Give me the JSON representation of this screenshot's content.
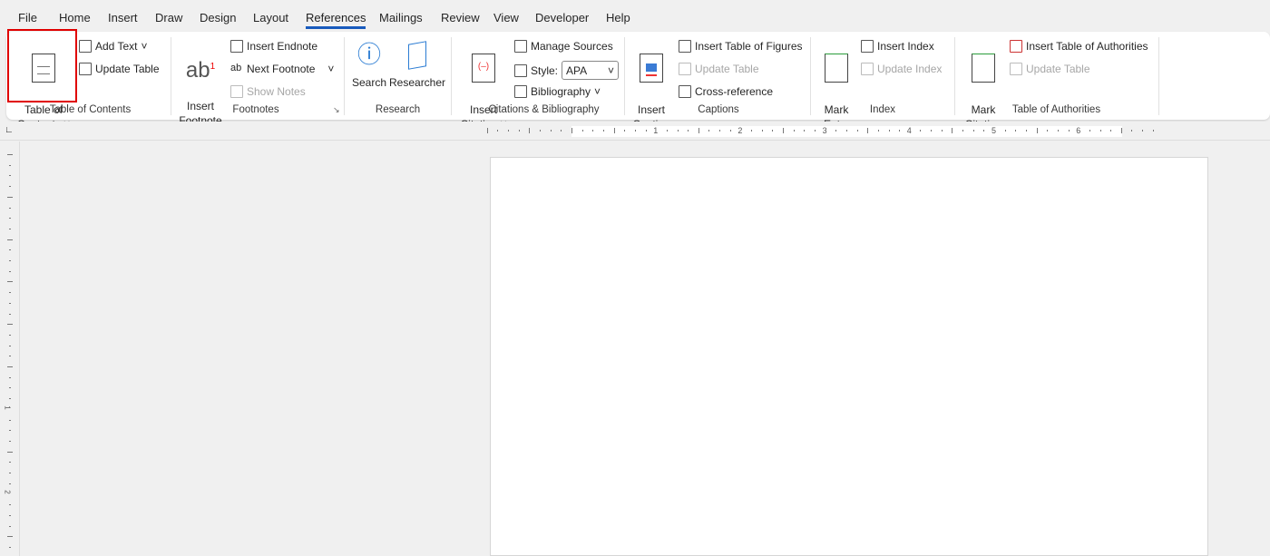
{
  "tabs": [
    "File",
    "Home",
    "Insert",
    "Draw",
    "Design",
    "Layout",
    "References",
    "Mailings",
    "Review",
    "View",
    "Developer",
    "Help"
  ],
  "active_tab": "References",
  "ribbon": {
    "toc": {
      "toc_button": "Table of\nContents",
      "add_text": "Add Text",
      "update_table": "Update Table",
      "group": "Table of Contents"
    },
    "footnotes": {
      "insert_footnote": "Insert\nFootnote",
      "insert_endnote": "Insert Endnote",
      "next_footnote": "Next Footnote",
      "show_notes": "Show Notes",
      "group": "Footnotes"
    },
    "research": {
      "search": "Search",
      "researcher": "Researcher",
      "group": "Research"
    },
    "citations": {
      "insert_citation": "Insert\nCitation",
      "manage_sources": "Manage Sources",
      "style_label": "Style:",
      "style_value": "APA",
      "bibliography": "Bibliography",
      "group": "Citations & Bibliography"
    },
    "captions": {
      "insert_caption": "Insert\nCaption",
      "insert_tof": "Insert Table of Figures",
      "update_table": "Update Table",
      "cross_reference": "Cross-reference",
      "group": "Captions"
    },
    "index": {
      "mark_entry": "Mark\nEntry",
      "insert_index": "Insert Index",
      "update_index": "Update Index",
      "group": "Index"
    },
    "authorities": {
      "mark_citation": "Mark\nCitation",
      "insert_toa": "Insert Table of Authorities",
      "update_table": "Update Table",
      "group": "Table of Authorities"
    }
  },
  "ruler": {
    "h_labels": [
      "1",
      "2",
      "3",
      "4",
      "5",
      "6"
    ],
    "v_labels": [
      "1",
      "2",
      "3"
    ]
  },
  "highlight_color": "#e00000",
  "accent": "#185abd"
}
